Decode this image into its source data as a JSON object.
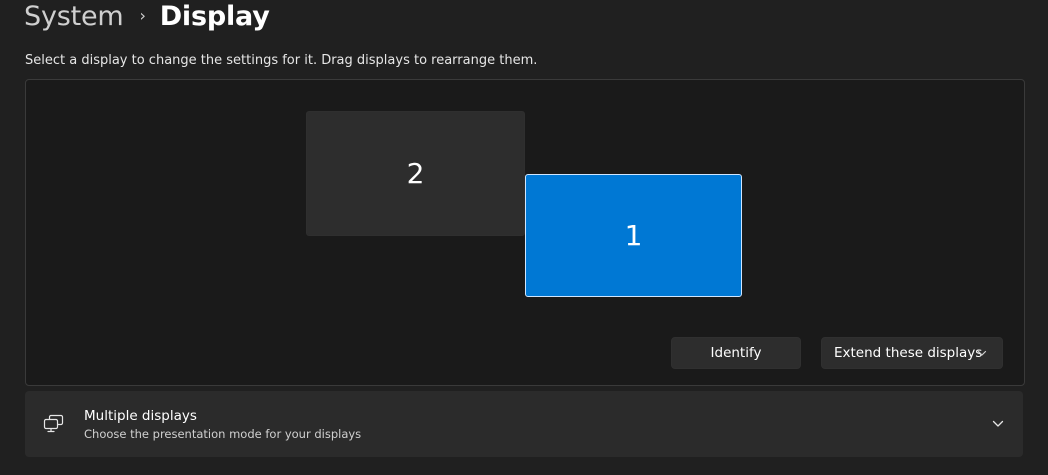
{
  "breadcrumb": {
    "parent": "System",
    "separator": "›",
    "current": "Display"
  },
  "description": "Select a display to change the settings for it. Drag displays to rearrange them.",
  "displays": [
    {
      "label": "2",
      "selected": false
    },
    {
      "label": "1",
      "selected": true
    }
  ],
  "actions": {
    "identify_label": "Identify",
    "mode_label": "Extend these displays"
  },
  "multiple_displays": {
    "title": "Multiple displays",
    "subtitle": "Choose the presentation mode for your displays",
    "icon": "multiple-displays-icon",
    "expanded": false
  },
  "colors": {
    "accent": "#0078d4",
    "background": "#202020",
    "canvas": "#1a1a1a",
    "card": "#2b2b2b"
  }
}
